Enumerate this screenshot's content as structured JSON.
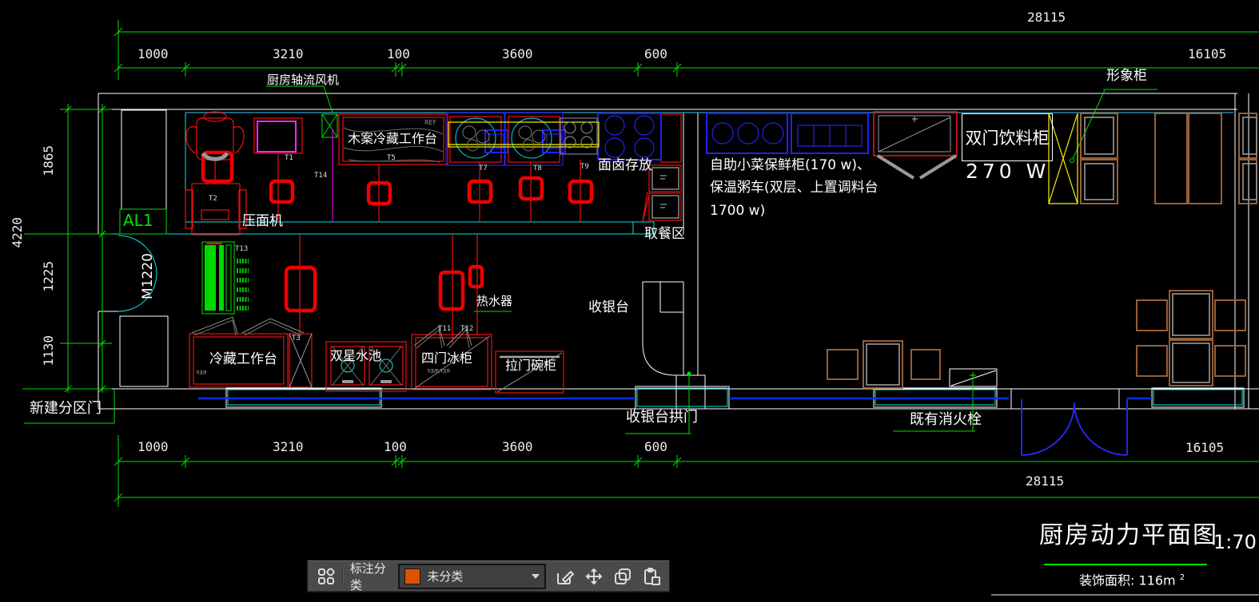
{
  "drawing": {
    "dim_top_total": "28115",
    "dim_top_segments": [
      "1000",
      "3210",
      "100",
      "3600",
      "600",
      "16105"
    ],
    "dim_bottom_segments": [
      "1000",
      "3210",
      "100",
      "3600",
      "600",
      "16105"
    ],
    "dim_bottom_total": "28115",
    "dim_left_total": "4220",
    "dim_left_segments": [
      "1865",
      "1225",
      "1130"
    ],
    "labels": {
      "axial_fan": "厨房轴流风机",
      "wood_cold_table": "木案冷藏工作台",
      "ref_tag": "REF",
      "fridge_ref": "REF/REF",
      "noodle_machine": "压面机",
      "panel": "AL1",
      "door_left": "M1220",
      "braised_storage": "面卤存放",
      "pickup_area": "取餐区",
      "cashier": "收银台",
      "water_heater": "热水器",
      "cold_worktable": "冷藏工作台",
      "double_sink": "双星水池",
      "four_door_fridge": "四门冰柜",
      "sliding_cupboard": "拉门碗柜",
      "new_partition_door": "新建分区门",
      "cashier_arch": "收银台拱门",
      "fire_hydrant": "既有消火栓",
      "image_cabinet": "形象柜",
      "drink_cabinet": "双门饮料柜",
      "drink_cabinet_power": "270 W",
      "note_line1": "自助小菜保鲜柜(170 w)、",
      "note_line2": "保温粥车(双层、上置调料台",
      "note_line3": "1700 w)"
    },
    "tags": [
      "T1",
      "T2",
      "T5",
      "T7",
      "T8",
      "T9",
      "T11",
      "T12",
      "T13",
      "T14",
      "T3"
    ],
    "title": {
      "name": "厨房动力平面图",
      "scale": "1:70",
      "area": "装饰面积: 116m",
      "area_sup": "2"
    },
    "colors": {
      "dimension_green": "#00E100",
      "outlet_red": "#F00000",
      "glass_cyan": "#00E8E8",
      "equipment_blue": "#2222EE",
      "window_blue": "#0B2FE0",
      "highlight_yellow": "#F5F500",
      "machine_magenta": "#FF26FF",
      "furniture_brown": "#A8693C",
      "wall_white": "#FFFFFF"
    }
  },
  "toolbar": {
    "category_label": "标注分类",
    "selected_category": "未分类",
    "swatch_color": "#DC5201"
  }
}
